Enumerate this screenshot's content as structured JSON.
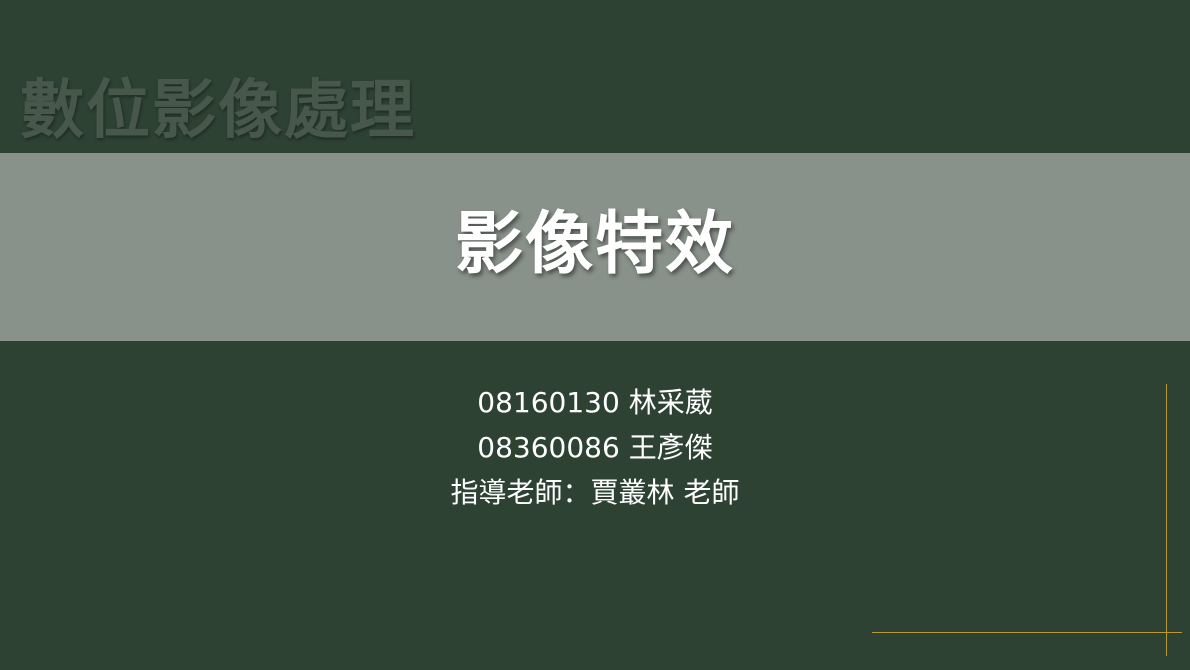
{
  "slide": {
    "course_title": "數位影像處理",
    "main_title": "影像特效",
    "authors": [
      "08160130 林采葳",
      "08360086 王彥傑",
      "指導老師：賈叢林 老師"
    ]
  },
  "colors": {
    "background": "#2e4233",
    "band": "#89928a",
    "course_title": "#47584b",
    "text": "#ffffff",
    "accent_line": "#b8982f"
  }
}
